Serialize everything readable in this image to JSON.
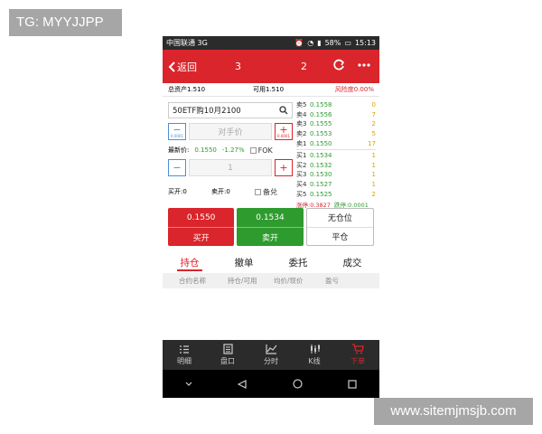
{
  "watermark": {
    "top": "TG: MYYJJPP",
    "bottom": "www.sitemjmsjb.com"
  },
  "status_bar": {
    "carrier": "中国联通 3G",
    "battery": "58%",
    "time": "15:13"
  },
  "header": {
    "back_label": "返回",
    "title_left": "3",
    "title_right": "2",
    "icons": [
      "refresh-icon",
      "more-icon"
    ],
    "color": "#d9252b"
  },
  "account": {
    "total_assets": "总资产1.510",
    "available": "可用1.510",
    "risk": "风险度0.00%"
  },
  "contract": {
    "code": "50ETF购10月2100"
  },
  "price_stepper": {
    "minus_sub": "0.0001",
    "plus_sub": "0.0001",
    "placeholder": "对手价"
  },
  "latest": {
    "label": "最新价:",
    "price": "0.1550",
    "change": "-1.27%",
    "fok_label": "FOK"
  },
  "qty_stepper": {
    "value": "1"
  },
  "open_info": {
    "buy_open": "买开:0",
    "sell_open": "卖开:0",
    "covered_label": "备兑"
  },
  "order_book": {
    "asks": [
      {
        "label": "卖5",
        "price": "0.1558",
        "qty": "0"
      },
      {
        "label": "卖4",
        "price": "0.1556",
        "qty": "7"
      },
      {
        "label": "卖3",
        "price": "0.1555",
        "qty": "2"
      },
      {
        "label": "卖2",
        "price": "0.1553",
        "qty": "5"
      },
      {
        "label": "卖1",
        "price": "0.1550",
        "qty": "17"
      }
    ],
    "bids": [
      {
        "label": "买1",
        "price": "0.1534",
        "qty": "1"
      },
      {
        "label": "买2",
        "price": "0.1532",
        "qty": "1"
      },
      {
        "label": "买3",
        "price": "0.1530",
        "qty": "1"
      },
      {
        "label": "买4",
        "price": "0.1527",
        "qty": "1"
      },
      {
        "label": "买5",
        "price": "0.1525",
        "qty": "2"
      }
    ],
    "limit_up": "涨停:0.3827",
    "limit_down": "跌停:0.0001"
  },
  "trade_buttons": {
    "buy": {
      "price": "0.1550",
      "label": "买开"
    },
    "sell": {
      "price": "0.1534",
      "label": "卖开"
    },
    "close": {
      "status": "无仓位",
      "label": "平仓"
    }
  },
  "tabs": [
    {
      "label": "持仓",
      "active": true
    },
    {
      "label": "撤单",
      "active": false
    },
    {
      "label": "委托",
      "active": false
    },
    {
      "label": "成交",
      "active": false
    }
  ],
  "columns": [
    "合约名称",
    "持仓/可用",
    "均价/现价",
    "盈亏"
  ],
  "bottom_nav": [
    {
      "label": "明细",
      "icon": "list-icon",
      "active": false
    },
    {
      "label": "盘口",
      "icon": "book-icon",
      "active": false
    },
    {
      "label": "分时",
      "icon": "chart-line-icon",
      "active": false
    },
    {
      "label": "K线",
      "icon": "candlestick-icon",
      "active": false
    },
    {
      "label": "下单",
      "icon": "cart-icon",
      "active": true
    }
  ]
}
